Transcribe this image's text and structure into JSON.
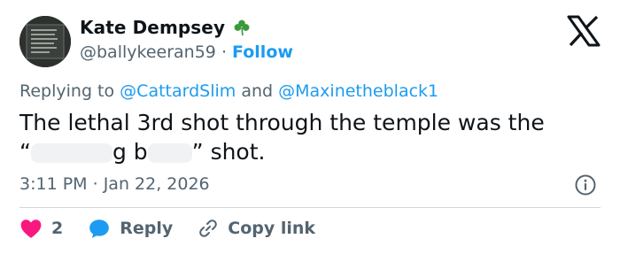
{
  "author": {
    "display_name": "Kate Dempsey",
    "handle": "@ballykeeran59",
    "separator": "·",
    "follow_label": "Follow",
    "avatar_icon": "chalkboard-avatar",
    "badge_icon": "shamrock-icon"
  },
  "reply_context": {
    "prefix": "Replying to",
    "user1": "@CattardSlim",
    "joiner": "and",
    "user2": "@Maxinetheblack1"
  },
  "tweet": {
    "line1": "The lethal 3rd shot through the temple was the",
    "open_quote": "“",
    "word1_fragment": "g",
    "word2_fragment": "b",
    "close_quote": "”",
    "tail": "shot."
  },
  "meta": {
    "time": "3:11 PM",
    "separator": "·",
    "date": "Jan 22, 2026"
  },
  "actions": {
    "like_count": "2",
    "reply_label": "Reply",
    "copy_label": "Copy link"
  },
  "colors": {
    "accent": "#1d9bf0",
    "like": "#f91880",
    "muted": "#536471",
    "text": "#0f1419"
  }
}
